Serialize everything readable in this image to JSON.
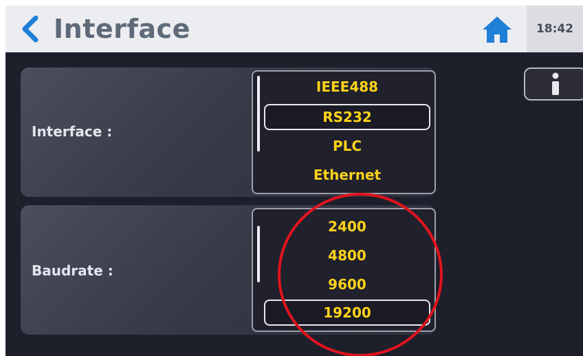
{
  "header": {
    "title": "Interface",
    "time": "18:42",
    "back_icon": "chevron-left-icon",
    "home_icon": "home-icon",
    "accent_color": "#1f7fd6"
  },
  "interface_panel": {
    "label": "Interface :",
    "options": [
      {
        "label": "IEEE488",
        "selected": false
      },
      {
        "label": "RS232",
        "selected": true
      },
      {
        "label": "PLC",
        "selected": false
      },
      {
        "label": "Ethernet",
        "selected": false
      }
    ]
  },
  "baudrate_panel": {
    "label": "Baudrate :",
    "options": [
      {
        "label": "2400",
        "selected": false
      },
      {
        "label": "4800",
        "selected": false
      },
      {
        "label": "9600",
        "selected": false
      },
      {
        "label": "19200",
        "selected": true
      }
    ]
  },
  "info_button": {
    "icon": "info-icon"
  },
  "colors": {
    "option_text": "#ffd21a",
    "highlight_circle": "#e0141e",
    "header_bg": "#ecedf1",
    "screen_bg": "#1d1f2b"
  }
}
